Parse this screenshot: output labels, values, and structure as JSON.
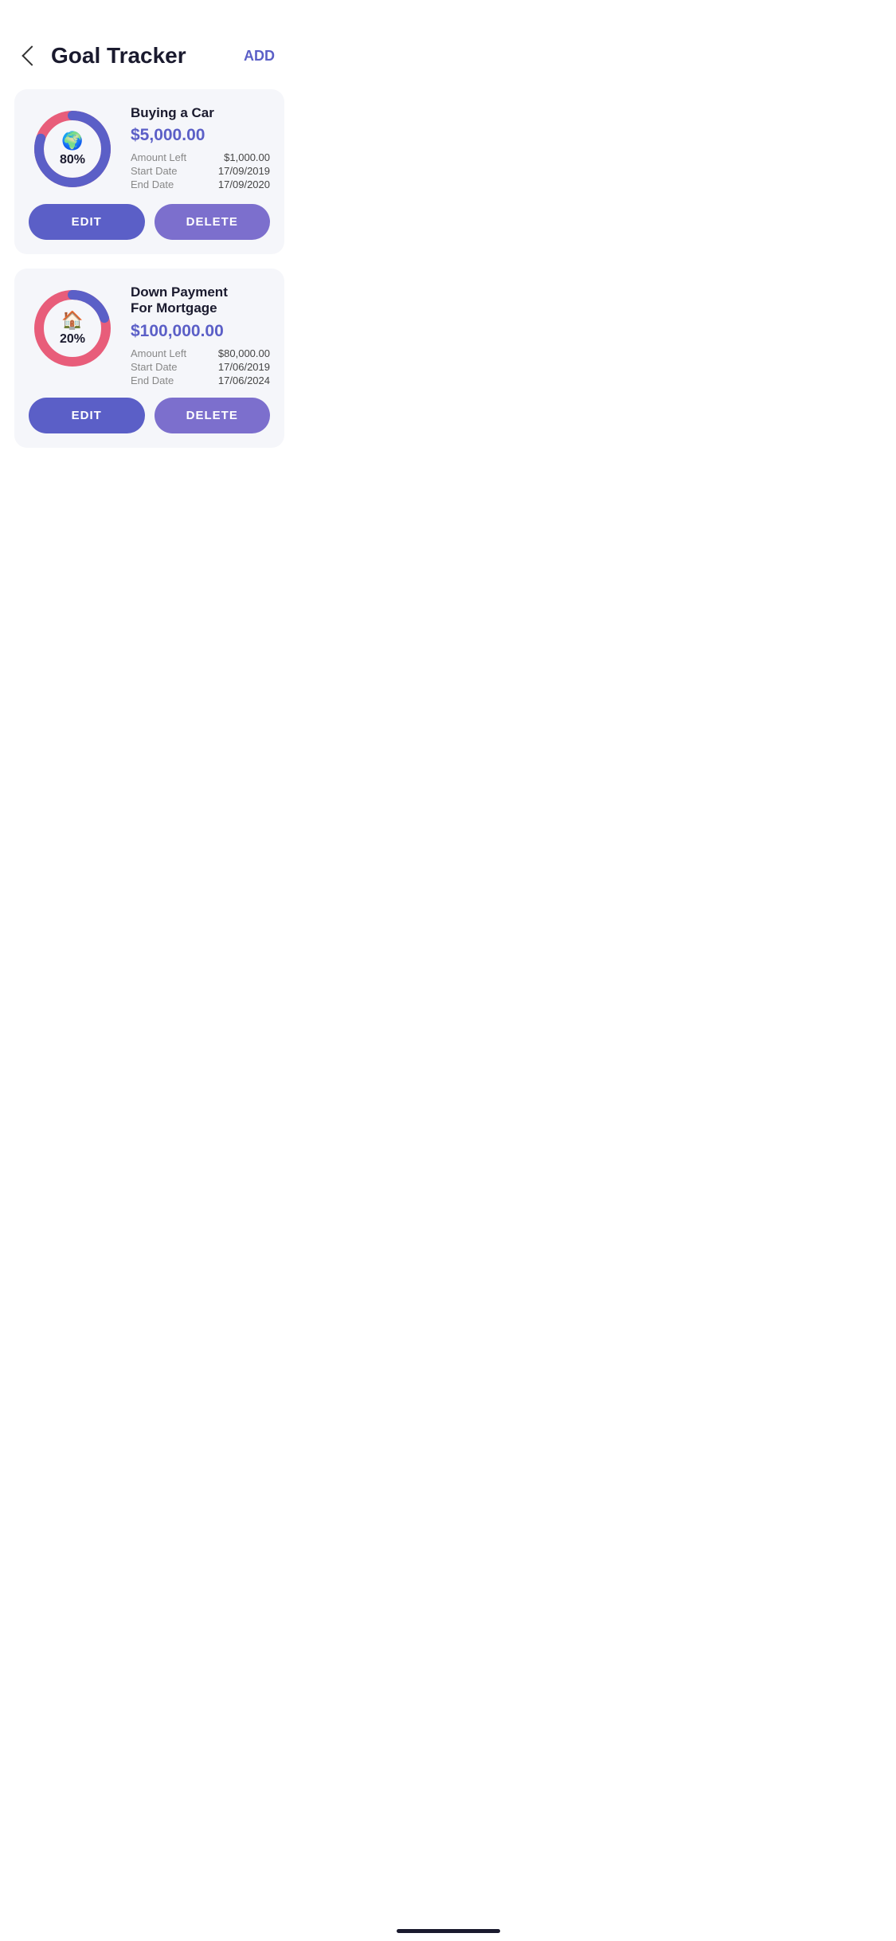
{
  "header": {
    "title": "Goal Tracker",
    "add_label": "ADD",
    "back_label": "back"
  },
  "goals": [
    {
      "id": "goal-1",
      "name": "Buying a Car",
      "amount": "$5,000.00",
      "amount_left_label": "Amount Left",
      "amount_left_value": "$1,000.00",
      "start_date_label": "Start Date",
      "start_date_value": "17/09/2019",
      "end_date_label": "End Date",
      "end_date_value": "17/09/2020",
      "percentage": 80,
      "icon": "🌍",
      "edit_label": "EDIT",
      "delete_label": "DELETE",
      "color_progress": "#5b5fc7",
      "color_remaining": "#e85d7a"
    },
    {
      "id": "goal-2",
      "name": "Down Payment\nFor Mortgage",
      "name_line1": "Down Payment",
      "name_line2": "For Mortgage",
      "amount": "$100,000.00",
      "amount_left_label": "Amount Left",
      "amount_left_value": "$80,000.00",
      "start_date_label": "Start Date",
      "start_date_value": "17/06/2019",
      "end_date_label": "End Date",
      "end_date_value": "17/06/2024",
      "percentage": 20,
      "icon": "🏠",
      "edit_label": "EDIT",
      "delete_label": "DELETE",
      "color_progress": "#5b5fc7",
      "color_remaining": "#e85d7a"
    }
  ]
}
